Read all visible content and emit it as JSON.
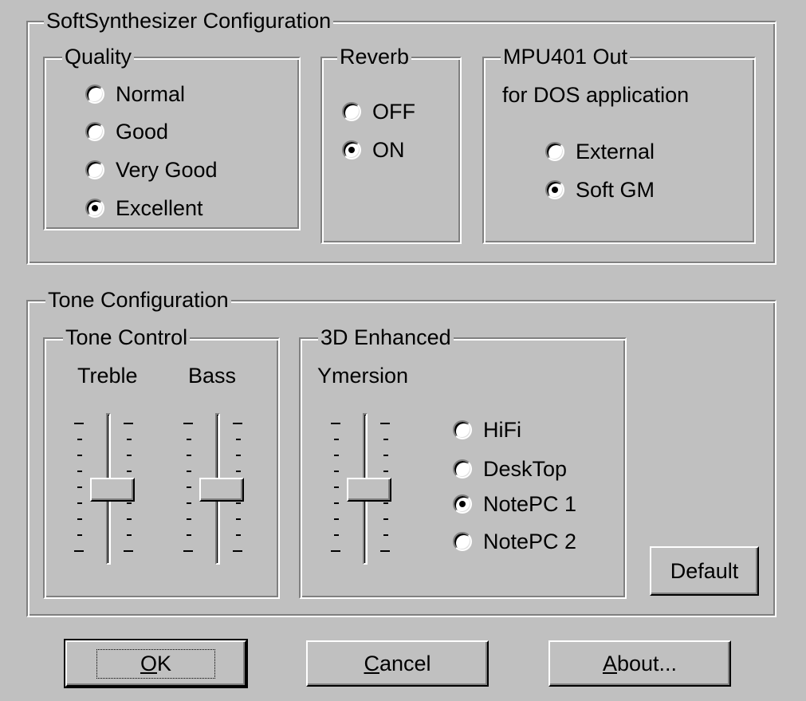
{
  "synth": {
    "title": "SoftSynthesizer Configuration",
    "quality": {
      "title": "Quality",
      "options": [
        {
          "label": "Normal",
          "selected": false
        },
        {
          "label": "Good",
          "selected": false
        },
        {
          "label": "Very Good",
          "selected": false
        },
        {
          "label": "Excellent",
          "selected": true
        }
      ]
    },
    "reverb": {
      "title": "Reverb",
      "options": [
        {
          "label": "OFF",
          "selected": false
        },
        {
          "label": "ON",
          "selected": true
        }
      ]
    },
    "mpu": {
      "title": "MPU401 Out",
      "subtitle": "for DOS application",
      "options": [
        {
          "label": "External",
          "selected": false
        },
        {
          "label": "Soft GM",
          "selected": true
        }
      ]
    }
  },
  "tone": {
    "title": "Tone Configuration",
    "control": {
      "title": "Tone Control",
      "treble_label": "Treble",
      "bass_label": "Bass",
      "treble_level": 0.5,
      "bass_level": 0.5
    },
    "enhanced": {
      "title": "3D Enhanced",
      "ymersion_label": "Ymersion",
      "ymersion_level": 0.5,
      "options": [
        {
          "label": "HiFi",
          "selected": false
        },
        {
          "label": "DeskTop",
          "selected": false
        },
        {
          "label": "NotePC 1",
          "selected": true
        },
        {
          "label": "NotePC 2",
          "selected": false
        }
      ]
    },
    "default_button": "Default"
  },
  "buttons": {
    "ok_mnemonic": "O",
    "ok_rest": "K",
    "cancel_mnemonic": "C",
    "cancel_rest": "ancel",
    "about_mnemonic": "A",
    "about_rest": "bout..."
  }
}
